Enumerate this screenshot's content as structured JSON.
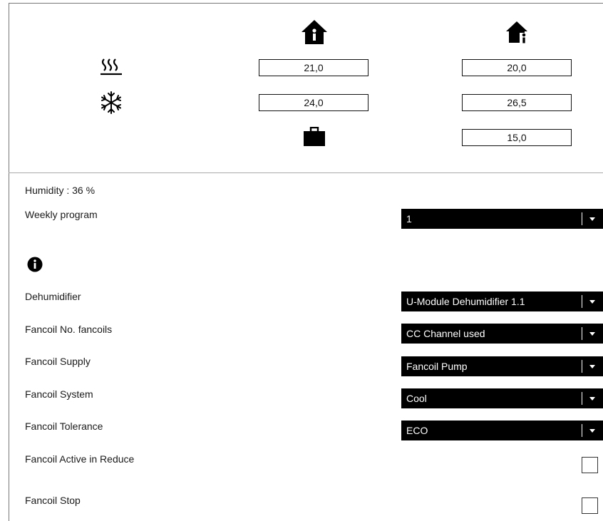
{
  "setpoints": {
    "heat_comfort": "21,0",
    "heat_reduced": "20,0",
    "cool_comfort": "24,0",
    "cool_reduced": "26,5",
    "away": "15,0"
  },
  "icons": {
    "comfort": "home-icon",
    "reduced": "home-person-icon",
    "heating": "heating-icon",
    "cooling": "snowflake-icon",
    "away": "briefcase-icon",
    "info": "info-icon"
  },
  "humidity": "Humidity : 36 %",
  "weekly_program": {
    "label": "Weekly program",
    "value": "1"
  },
  "dehumidifier": {
    "label": "Dehumidifier",
    "value": "U-Module Dehumidifier 1.1"
  },
  "fancoil_no": {
    "label": "Fancoil No. fancoils",
    "value": "CC Channel used"
  },
  "fancoil_supply": {
    "label": "Fancoil Supply",
    "value": "Fancoil Pump"
  },
  "fancoil_system": {
    "label": "Fancoil System",
    "value": "Cool"
  },
  "fancoil_tolerance": {
    "label": "Fancoil Tolerance",
    "value": "ECO"
  },
  "fancoil_active_reduce": {
    "label": "Fancoil Active in Reduce",
    "checked": false
  },
  "fancoil_stop": {
    "label": "Fancoil Stop",
    "checked": false
  }
}
